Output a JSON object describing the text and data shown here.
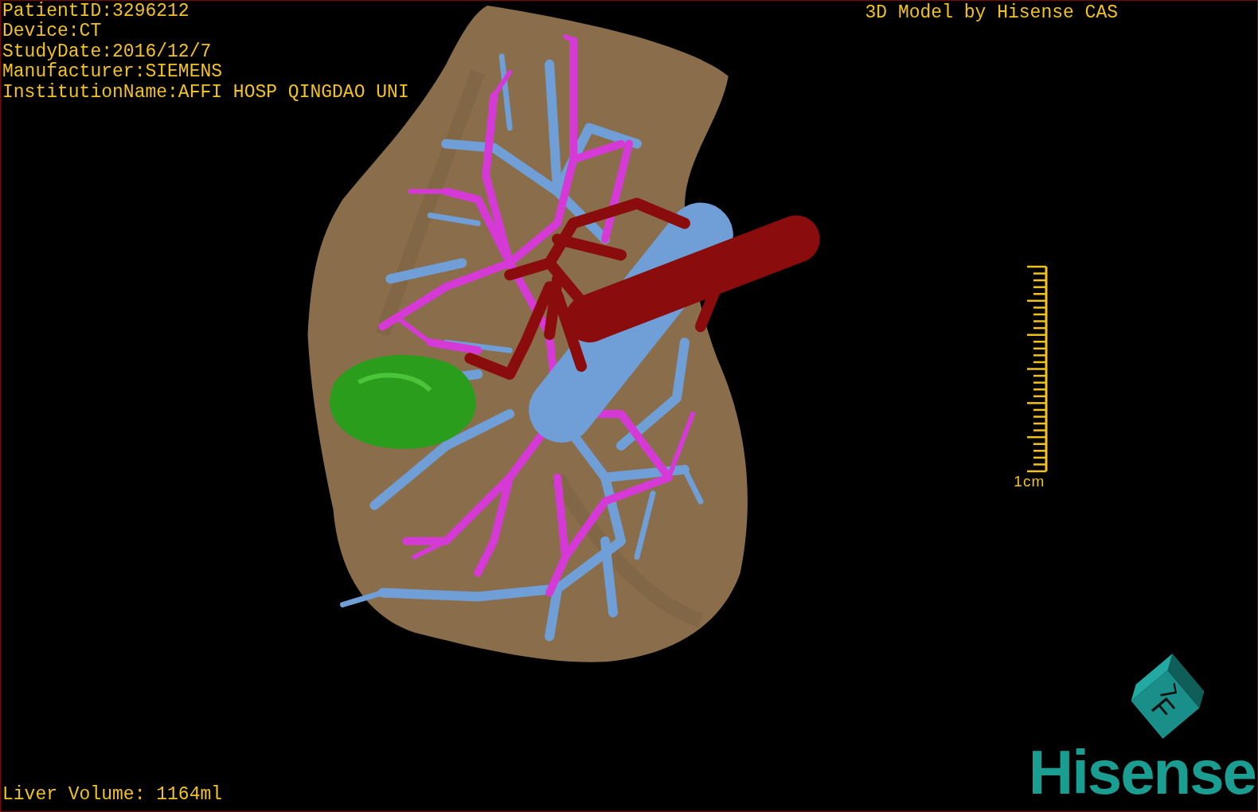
{
  "info_lines": [
    "PatientID:3296212",
    "Device:CT",
    "StudyDate:2016/12/7",
    "Manufacturer:SIEMENS",
    "InstitutionName:AFFI HOSP QINGDAO UNI"
  ],
  "title": "3D Model by Hisense CAS",
  "scale_bar": {
    "label": "1cm"
  },
  "orientation_cube": {
    "faces": [
      "F",
      "L"
    ]
  },
  "logo": "Hisense",
  "liver_volume": "Liver Volume: 1164ml"
}
